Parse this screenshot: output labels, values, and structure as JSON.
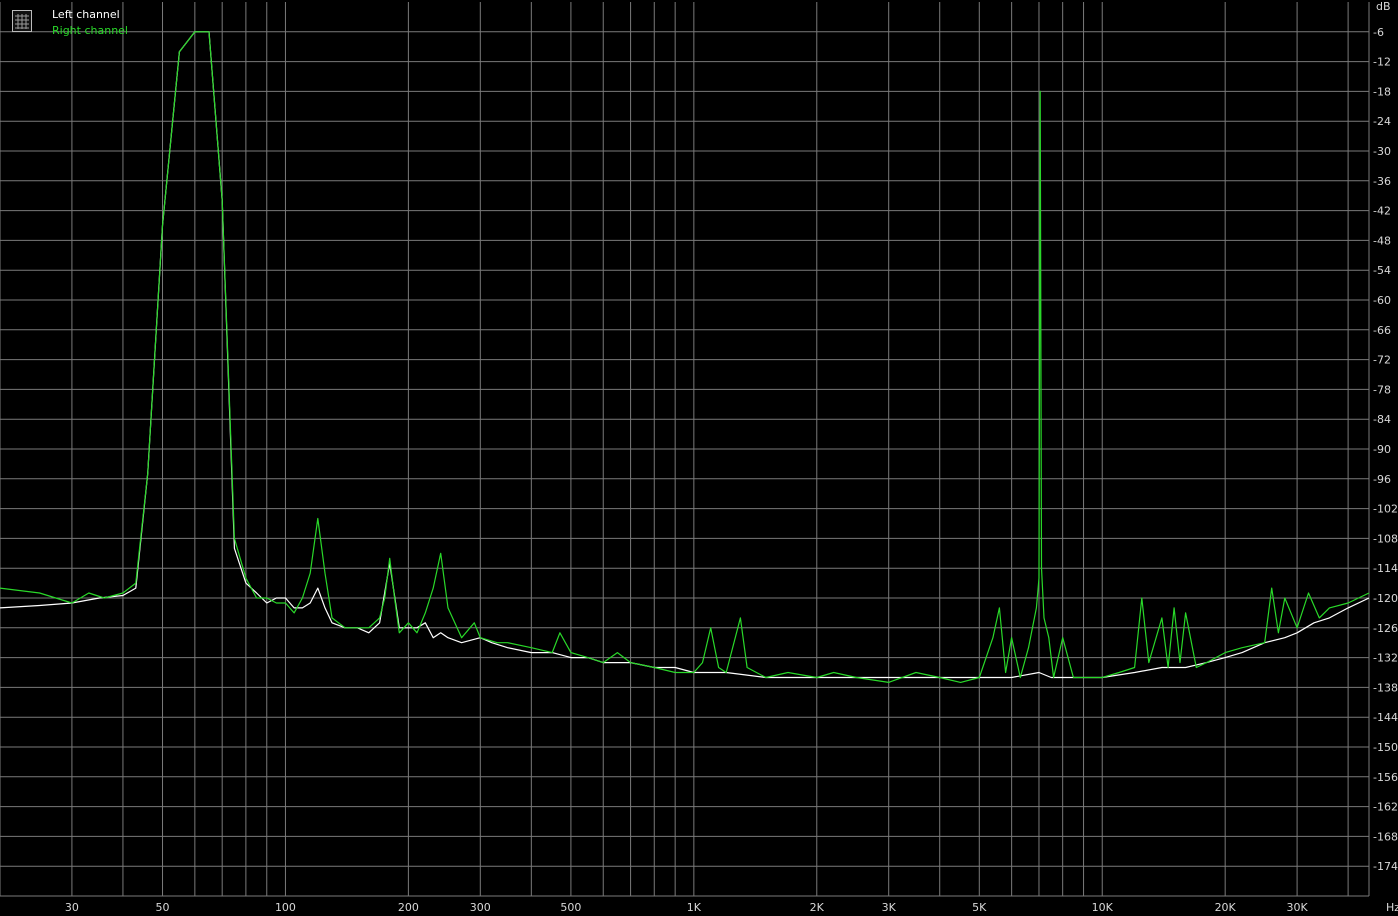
{
  "chart_data": {
    "type": "line",
    "title": "",
    "x_unit": "Hz",
    "y_unit": "dB",
    "x_scale": "log",
    "xlim": [
      20,
      45000
    ],
    "ylim": [
      -180,
      0
    ],
    "grid": true,
    "legend_placement": "top-left",
    "background": "#000000",
    "grid_color": "#7a7a7a",
    "x_tick_labels": [
      {
        "v": 30,
        "label": "30"
      },
      {
        "v": 50,
        "label": "50"
      },
      {
        "v": 100,
        "label": "100"
      },
      {
        "v": 200,
        "label": "200"
      },
      {
        "v": 300,
        "label": "300"
      },
      {
        "v": 500,
        "label": "500"
      },
      {
        "v": 1000,
        "label": "1K"
      },
      {
        "v": 2000,
        "label": "2K"
      },
      {
        "v": 3000,
        "label": "3K"
      },
      {
        "v": 5000,
        "label": "5K"
      },
      {
        "v": 10000,
        "label": "10K"
      },
      {
        "v": 20000,
        "label": "20K"
      },
      {
        "v": 30000,
        "label": "30K"
      }
    ],
    "y_ticks": [
      -6,
      -12,
      -18,
      -24,
      -30,
      -36,
      -42,
      -48,
      -54,
      -60,
      -66,
      -72,
      -78,
      -84,
      -90,
      -96,
      -102,
      -108,
      -114,
      -120,
      -126,
      -132,
      -138,
      -144,
      -150,
      -156,
      -162,
      -168,
      -174
    ],
    "series": [
      {
        "name": "Left channel",
        "color": "#ffffff",
        "points": [
          [
            20,
            -122
          ],
          [
            25,
            -121.5
          ],
          [
            30,
            -121
          ],
          [
            35,
            -120
          ],
          [
            40,
            -119.5
          ],
          [
            43,
            -118
          ],
          [
            46,
            -95
          ],
          [
            50,
            -45
          ],
          [
            55,
            -10
          ],
          [
            60,
            -6
          ],
          [
            65,
            -6
          ],
          [
            70,
            -40
          ],
          [
            75,
            -110
          ],
          [
            80,
            -117
          ],
          [
            85,
            -119
          ],
          [
            90,
            -121
          ],
          [
            95,
            -120
          ],
          [
            100,
            -120
          ],
          [
            105,
            -122
          ],
          [
            110,
            -122
          ],
          [
            115,
            -121
          ],
          [
            120,
            -118
          ],
          [
            125,
            -122
          ],
          [
            130,
            -125
          ],
          [
            140,
            -126
          ],
          [
            150,
            -126
          ],
          [
            160,
            -127
          ],
          [
            170,
            -125
          ],
          [
            180,
            -113
          ],
          [
            190,
            -126
          ],
          [
            200,
            -126
          ],
          [
            210,
            -126
          ],
          [
            220,
            -125
          ],
          [
            230,
            -128
          ],
          [
            240,
            -127
          ],
          [
            250,
            -128
          ],
          [
            270,
            -129
          ],
          [
            300,
            -128
          ],
          [
            320,
            -129
          ],
          [
            350,
            -130
          ],
          [
            400,
            -131
          ],
          [
            450,
            -131
          ],
          [
            500,
            -132
          ],
          [
            550,
            -132
          ],
          [
            600,
            -133
          ],
          [
            700,
            -133
          ],
          [
            800,
            -134
          ],
          [
            900,
            -134
          ],
          [
            1000,
            -135
          ],
          [
            1200,
            -135
          ],
          [
            1500,
            -136
          ],
          [
            2000,
            -136
          ],
          [
            2500,
            -136
          ],
          [
            3000,
            -136
          ],
          [
            4000,
            -136
          ],
          [
            5000,
            -136
          ],
          [
            6000,
            -136
          ],
          [
            7000,
            -135
          ],
          [
            7500,
            -136
          ],
          [
            8000,
            -136
          ],
          [
            9000,
            -136
          ],
          [
            10000,
            -136
          ],
          [
            12000,
            -135
          ],
          [
            14000,
            -134
          ],
          [
            16000,
            -134
          ],
          [
            18000,
            -133
          ],
          [
            20000,
            -132
          ],
          [
            22000,
            -131
          ],
          [
            25000,
            -129
          ],
          [
            28000,
            -128
          ],
          [
            30000,
            -127
          ],
          [
            33000,
            -125
          ],
          [
            36000,
            -124
          ],
          [
            40000,
            -122
          ],
          [
            45000,
            -120
          ]
        ]
      },
      {
        "name": "Right channel",
        "color": "#29d829",
        "points": [
          [
            20,
            -118
          ],
          [
            25,
            -119
          ],
          [
            30,
            -121
          ],
          [
            33,
            -119
          ],
          [
            36,
            -120
          ],
          [
            40,
            -119
          ],
          [
            43,
            -117
          ],
          [
            46,
            -95
          ],
          [
            50,
            -45
          ],
          [
            55,
            -10
          ],
          [
            60,
            -6
          ],
          [
            65,
            -6
          ],
          [
            70,
            -40
          ],
          [
            75,
            -108
          ],
          [
            80,
            -116
          ],
          [
            85,
            -120
          ],
          [
            90,
            -120
          ],
          [
            95,
            -121
          ],
          [
            100,
            -121
          ],
          [
            105,
            -123
          ],
          [
            110,
            -120
          ],
          [
            115,
            -115
          ],
          [
            120,
            -104
          ],
          [
            125,
            -115
          ],
          [
            130,
            -124
          ],
          [
            140,
            -126
          ],
          [
            150,
            -126
          ],
          [
            160,
            -126
          ],
          [
            170,
            -124
          ],
          [
            175,
            -120
          ],
          [
            180,
            -112
          ],
          [
            185,
            -120
          ],
          [
            190,
            -127
          ],
          [
            200,
            -125
          ],
          [
            210,
            -127
          ],
          [
            220,
            -123
          ],
          [
            230,
            -118
          ],
          [
            240,
            -111
          ],
          [
            250,
            -122
          ],
          [
            270,
            -128
          ],
          [
            290,
            -125
          ],
          [
            300,
            -128
          ],
          [
            330,
            -129
          ],
          [
            350,
            -129
          ],
          [
            400,
            -130
          ],
          [
            450,
            -131
          ],
          [
            470,
            -127
          ],
          [
            500,
            -131
          ],
          [
            550,
            -132
          ],
          [
            600,
            -133
          ],
          [
            650,
            -131
          ],
          [
            700,
            -133
          ],
          [
            800,
            -134
          ],
          [
            900,
            -135
          ],
          [
            1000,
            -135
          ],
          [
            1050,
            -133
          ],
          [
            1100,
            -126
          ],
          [
            1150,
            -134
          ],
          [
            1200,
            -135
          ],
          [
            1300,
            -124
          ],
          [
            1350,
            -134
          ],
          [
            1500,
            -136
          ],
          [
            1700,
            -135
          ],
          [
            2000,
            -136
          ],
          [
            2200,
            -135
          ],
          [
            2500,
            -136
          ],
          [
            3000,
            -137
          ],
          [
            3500,
            -135
          ],
          [
            4000,
            -136
          ],
          [
            4500,
            -137
          ],
          [
            5000,
            -136
          ],
          [
            5400,
            -128
          ],
          [
            5600,
            -122
          ],
          [
            5800,
            -135
          ],
          [
            6000,
            -128
          ],
          [
            6300,
            -136
          ],
          [
            6600,
            -130
          ],
          [
            6900,
            -122
          ],
          [
            7000,
            -116
          ],
          [
            7050,
            -18
          ],
          [
            7100,
            -114
          ],
          [
            7200,
            -124
          ],
          [
            7400,
            -128
          ],
          [
            7600,
            -136
          ],
          [
            8000,
            -128
          ],
          [
            8500,
            -136
          ],
          [
            9000,
            -136
          ],
          [
            10000,
            -136
          ],
          [
            11000,
            -135
          ],
          [
            12000,
            -134
          ],
          [
            12500,
            -120
          ],
          [
            13000,
            -133
          ],
          [
            14000,
            -124
          ],
          [
            14500,
            -134
          ],
          [
            15000,
            -122
          ],
          [
            15500,
            -133
          ],
          [
            16000,
            -123
          ],
          [
            17000,
            -134
          ],
          [
            18000,
            -133
          ],
          [
            20000,
            -131
          ],
          [
            22000,
            -130
          ],
          [
            25000,
            -129
          ],
          [
            26000,
            -118
          ],
          [
            27000,
            -127
          ],
          [
            28000,
            -120
          ],
          [
            30000,
            -126
          ],
          [
            32000,
            -119
          ],
          [
            34000,
            -124
          ],
          [
            36000,
            -122
          ],
          [
            40000,
            -121
          ],
          [
            45000,
            -119
          ]
        ]
      }
    ]
  }
}
